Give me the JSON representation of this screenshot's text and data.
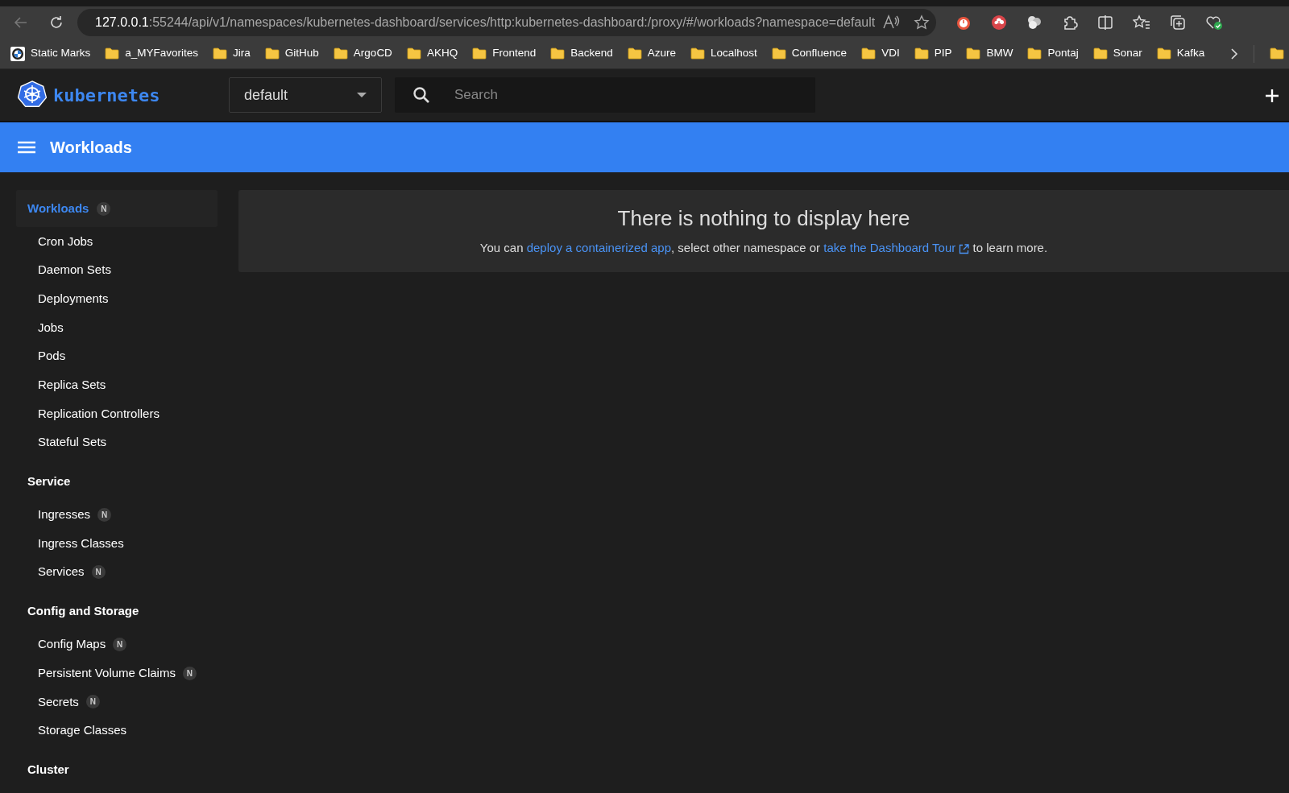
{
  "browser": {
    "url_host": "127.0.0.1",
    "url_rest": ":55244/api/v1/namespaces/kubernetes-dashboard/services/http:kubernetes-dashboard:/proxy/#/workloads?namespace=default",
    "bookmarks": [
      {
        "label": "Static Marks",
        "kind": "site"
      },
      {
        "label": "a_MYFavorites",
        "kind": "folder"
      },
      {
        "label": "Jira",
        "kind": "folder"
      },
      {
        "label": "GitHub",
        "kind": "folder"
      },
      {
        "label": "ArgoCD",
        "kind": "folder"
      },
      {
        "label": "AKHQ",
        "kind": "folder"
      },
      {
        "label": "Frontend",
        "kind": "folder"
      },
      {
        "label": "Backend",
        "kind": "folder"
      },
      {
        "label": "Azure",
        "kind": "folder"
      },
      {
        "label": "Localhost",
        "kind": "folder"
      },
      {
        "label": "Confluence",
        "kind": "folder"
      },
      {
        "label": "VDI",
        "kind": "folder"
      },
      {
        "label": "PIP",
        "kind": "folder"
      },
      {
        "label": "BMW",
        "kind": "folder"
      },
      {
        "label": "Pontaj",
        "kind": "folder"
      },
      {
        "label": "Sonar",
        "kind": "folder"
      },
      {
        "label": "Kafka",
        "kind": "folder"
      }
    ]
  },
  "app": {
    "logo": "kubernetes",
    "namespace": "default",
    "search_placeholder": "Search",
    "page_title": "Workloads"
  },
  "sidebar": [
    {
      "title": "Workloads",
      "selected": true,
      "badge": "N",
      "items": [
        {
          "label": "Cron Jobs"
        },
        {
          "label": "Daemon Sets"
        },
        {
          "label": "Deployments"
        },
        {
          "label": "Jobs"
        },
        {
          "label": "Pods"
        },
        {
          "label": "Replica Sets"
        },
        {
          "label": "Replication Controllers"
        },
        {
          "label": "Stateful Sets"
        }
      ]
    },
    {
      "title": "Service",
      "selected": false,
      "items": [
        {
          "label": "Ingresses",
          "badge": "N"
        },
        {
          "label": "Ingress Classes"
        },
        {
          "label": "Services",
          "badge": "N"
        }
      ]
    },
    {
      "title": "Config and Storage",
      "selected": false,
      "items": [
        {
          "label": "Config Maps",
          "badge": "N"
        },
        {
          "label": "Persistent Volume Claims",
          "badge": "N"
        },
        {
          "label": "Secrets",
          "badge": "N"
        },
        {
          "label": "Storage Classes"
        }
      ]
    },
    {
      "title": "Cluster",
      "selected": false
    }
  ],
  "empty_state": {
    "title": "There is nothing to display here",
    "message": [
      {
        "kind": "text",
        "text": "You can "
      },
      {
        "kind": "link",
        "text": "deploy a containerized app"
      },
      {
        "kind": "text",
        "text": ", select other namespace or "
      },
      {
        "kind": "external_link",
        "text": "take the Dashboard Tour"
      },
      {
        "kind": "text",
        "text": " to learn more."
      }
    ]
  }
}
